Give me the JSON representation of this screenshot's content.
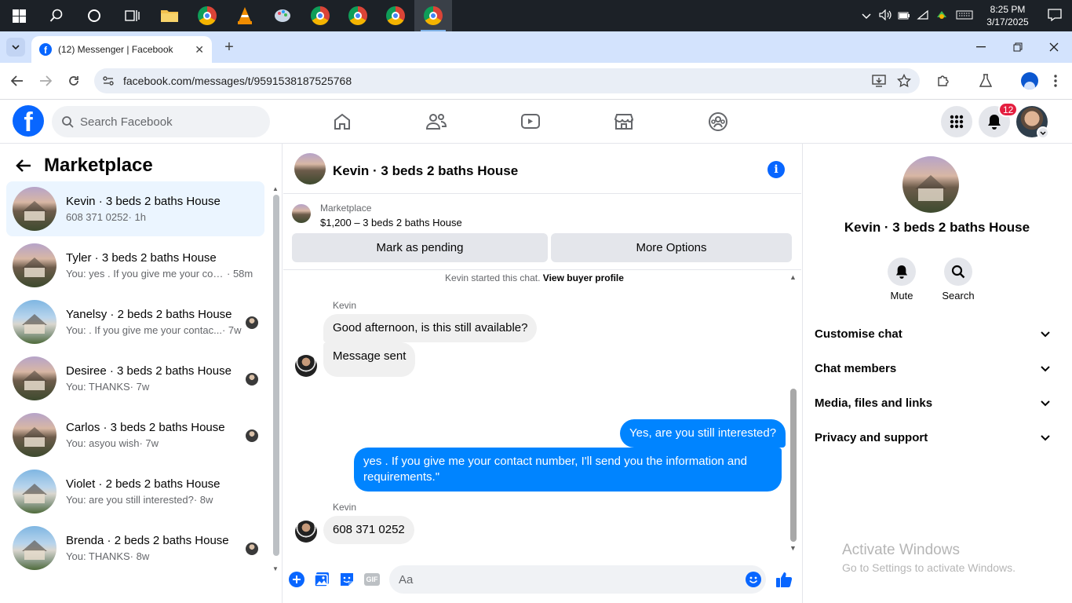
{
  "taskbar": {
    "time": "8:25 PM",
    "date": "3/17/2025"
  },
  "browser": {
    "tab_title": "(12) Messenger | Facebook",
    "url": "facebook.com/messages/t/9591538187525768"
  },
  "facebook": {
    "search_placeholder": "Search Facebook",
    "notification_count": "12"
  },
  "left_panel": {
    "title": "Marketplace",
    "conversations": [
      {
        "title": "Kevin · 3 beds 2 baths House",
        "preview": "608 371 0252",
        "time": "· 1h"
      },
      {
        "title": "Tyler · 3 beds 2 baths House",
        "preview": "You: yes . If you give me your con...",
        "time": "· 58m"
      },
      {
        "title": "Yanelsy · 2 beds 2 baths House",
        "preview": "You: . If you give me your contac...",
        "time": "· 7w"
      },
      {
        "title": "Desiree · 3 beds 2 baths House",
        "preview": "You: THANKS",
        "time": "· 7w"
      },
      {
        "title": "Carlos · 3 beds 2 baths House",
        "preview": "You: asyou wish",
        "time": "· 7w"
      },
      {
        "title": "Violet · 2 beds 2 baths House",
        "preview": "You: are you still interested?",
        "time": "· 8w"
      },
      {
        "title": "Brenda · 2 beds 2 baths House",
        "preview": "You: THANKS",
        "time": "· 8w"
      }
    ]
  },
  "chat": {
    "title": "Kevin · 3 beds 2 baths House",
    "marketplace_label": "Marketplace",
    "listing": "$1,200 – 3 beds 2 baths House",
    "mark_pending": "Mark as pending",
    "more_options": "More Options",
    "started_text": "Kevin started this chat.",
    "view_buyer": "View buyer profile",
    "sender1": "Kevin",
    "msg1": "Good afternoon, is this still available?",
    "msg2": "Message sent",
    "msg3": "Yes, are you still interested?",
    "msg4_line1": "yes . If you give me your contact number, I'll send you the information and",
    "msg4_line2": "requirements.\"",
    "sender2": "Kevin",
    "msg5": "608 371 0252",
    "composer_placeholder": "Aa"
  },
  "right_panel": {
    "name": "Kevin · 3 beds 2 baths House",
    "mute": "Mute",
    "search": "Search",
    "sections": [
      "Customise chat",
      "Chat members",
      "Media, files and links",
      "Privacy and support"
    ]
  },
  "watermark": {
    "line1": "Activate Windows",
    "line2": "Go to Settings to activate Windows."
  },
  "colors": {
    "accent": "#0866ff",
    "messenger_blue": "#0084ff",
    "selected_bg": "#ebf5ff"
  }
}
